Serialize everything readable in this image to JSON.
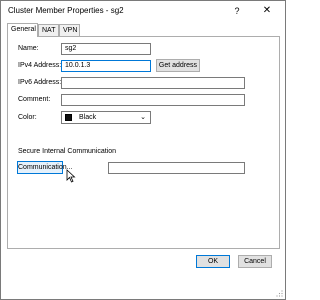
{
  "window": {
    "title": "Cluster Member Properties - sg2",
    "help_glyph": "?",
    "close_glyph": "✕"
  },
  "tabs": [
    {
      "label": "General",
      "active": true
    },
    {
      "label": "NAT",
      "active": false
    },
    {
      "label": "VPN",
      "active": false
    }
  ],
  "form": {
    "name_label": "Name:",
    "name_value": "sg2",
    "ipv4_label": "IPv4 Address:",
    "ipv4_value": "10.0.1.3",
    "get_address_label": "Get address",
    "ipv6_label": "IPv6 Address:",
    "ipv6_value": "",
    "comment_label": "Comment:",
    "comment_value": "",
    "color_label": "Color:",
    "color_value": "Black",
    "color_swatch": "#111111"
  },
  "sic": {
    "section_label": "Secure Internal Communication",
    "communication_label": "Communication...",
    "status_value": ""
  },
  "footer": {
    "ok_label": "OK",
    "cancel_label": "Cancel"
  },
  "colors": {
    "focus_border": "#0078d7",
    "button_face": "#e1e1e1"
  }
}
